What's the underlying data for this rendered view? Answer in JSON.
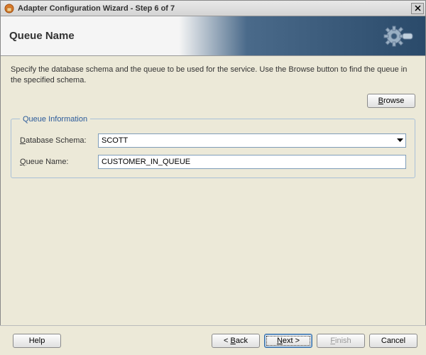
{
  "window": {
    "title": "Adapter Configuration Wizard - Step 6 of 7"
  },
  "banner": {
    "title": "Queue Name"
  },
  "instruction": "Specify the database schema and the queue to be used for the service. Use the Browse button to find the queue in the specified schema.",
  "buttons": {
    "browse": "Browse",
    "help": "Help",
    "back": "< Back",
    "next": "Next >",
    "finish": "Finish",
    "cancel": "Cancel"
  },
  "group": {
    "legend": "Queue Information",
    "schema_label": "Database Schema:",
    "schema_value": "SCOTT",
    "queue_label": "Queue Name:",
    "queue_value": "CUSTOMER_IN_QUEUE"
  }
}
